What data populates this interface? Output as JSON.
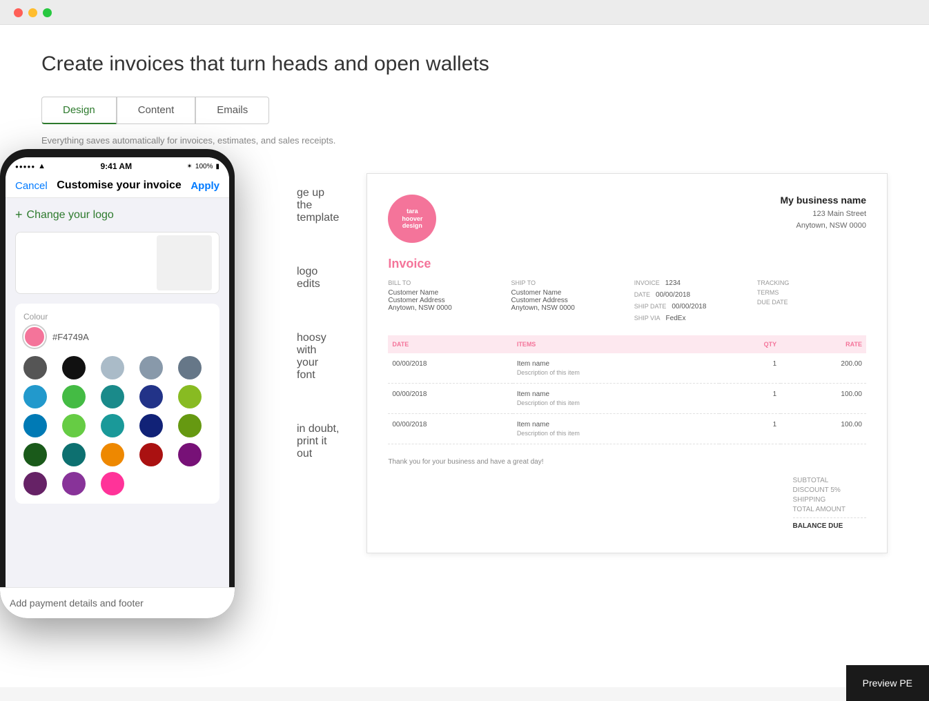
{
  "browser": {
    "traffic_lights": [
      "#ff5f57",
      "#ffbd2e",
      "#28c840"
    ]
  },
  "page": {
    "title": "Create invoices that turn heads and open wallets"
  },
  "tabs": [
    {
      "id": "design",
      "label": "Design",
      "active": true
    },
    {
      "id": "content",
      "label": "Content",
      "active": false
    },
    {
      "id": "emails",
      "label": "Emails",
      "active": false
    }
  ],
  "tab_description": "Everything saves automatically for invoices, estimates, and sales receipts.",
  "features": [
    "ge up the template",
    "logo edits",
    "hoosy with your font",
    "in doubt, print it out"
  ],
  "phone": {
    "status_bar": {
      "signal": "●●●●●",
      "wifi": "▲",
      "time": "9:41 AM",
      "battery_text": "100%"
    },
    "nav": {
      "cancel": "Cancel",
      "title": "Customise your invoice",
      "apply": "Apply"
    },
    "change_logo": "+ Change your logo",
    "colour_label": "Colour",
    "colour_hex": "#F4749A",
    "swatches": [
      "#555555",
      "#111111",
      "#aabbc8",
      "#8899aa",
      "#667788",
      "#2299cc",
      "#44bb44",
      "#1a8a8a",
      "#223388",
      "#88bb22",
      "#007ab5",
      "#66cc44",
      "#1a9999",
      "#112277",
      "#669911",
      "#1a5a1a",
      "#0d7070",
      "#ee8800",
      "#aa1111",
      "#771177",
      "#662266",
      "#883399",
      "#ff3399"
    ],
    "payment_footer": "Add payment details and footer"
  },
  "invoice": {
    "logo_text": "tara\nhoover\ndesign",
    "business_name": "My business name",
    "business_address": "123 Main Street",
    "business_city": "Anytown, NSW 0000",
    "title": "Invoice",
    "bill_to_label": "BILL TO",
    "ship_to_label": "SHIP TO",
    "invoice_label": "INVOICE",
    "date_label": "DATE",
    "ship_date_label": "SHIP DATE",
    "ship_via_label": "SHIP VIA",
    "tracking_label": "TRACKING",
    "terms_label": "TERMS",
    "due_date_label": "DUE DATE",
    "customer_name": "Customer Name",
    "customer_address": "Customer Address",
    "customer_city": "Anytown, NSW 0000",
    "invoice_number": "1234",
    "date": "00/00/2018",
    "ship_date": "00/00/2018",
    "ship_via": "FedEx",
    "columns": [
      "DATE",
      "ITEMS",
      "QTY",
      "RATE"
    ],
    "rows": [
      {
        "date": "00/00/2018",
        "item": "Item name",
        "desc": "Description of this item",
        "qty": "1",
        "rate": "200.00"
      },
      {
        "date": "00/00/2018",
        "item": "Item name",
        "desc": "Description of this item",
        "qty": "1",
        "rate": "100.00"
      },
      {
        "date": "00/00/2018",
        "item": "Item name",
        "desc": "Description of this item",
        "qty": "1",
        "rate": "100.00"
      }
    ],
    "footer_note": "Thank you for your business and have a great day!",
    "subtotal_label": "SUBTOTAL",
    "discount_label": "DISCOUNT 5%",
    "shipping_label": "SHIPPING",
    "total_label": "TOTAL AMOUNT",
    "balance_label": "BALANCE DUE",
    "accent_color": "#f4749a"
  },
  "preview_button": "Preview PE"
}
